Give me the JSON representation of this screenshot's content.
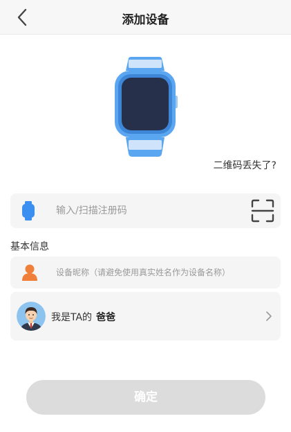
{
  "header": {
    "title": "添加设备",
    "back_icon": "chevron-left-icon"
  },
  "device_image": {
    "icon": "smartwatch-icon",
    "accent_color": "#5aa6f0",
    "screen_color": "#26304a"
  },
  "lost_code_link": "二维码丢失了?",
  "registration": {
    "placeholder": "输入/扫描注册码",
    "lead_icon": "watch-icon",
    "scan_icon": "scan-icon",
    "icon_color": "#3a8ff0"
  },
  "basic_info": {
    "label": "基本信息"
  },
  "nickname": {
    "placeholder": "设备昵称（请避免使用真实姓名作为设备名称）",
    "lead_icon": "person-icon",
    "icon_color": "#f07f3a"
  },
  "relation": {
    "prefix": "我是TA的",
    "value": "爸爸",
    "avatar_icon": "dad-avatar-icon",
    "chevron_icon": "chevron-right-icon"
  },
  "confirm_button": {
    "label": "确定",
    "enabled": false,
    "color": "#dcdcdc"
  }
}
